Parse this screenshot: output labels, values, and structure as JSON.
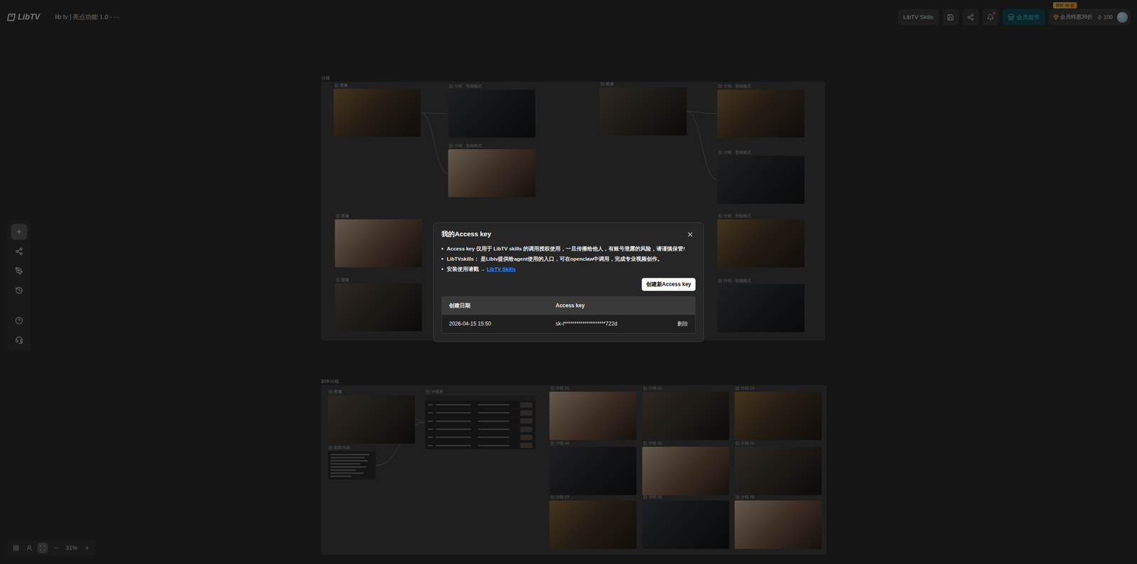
{
  "header": {
    "logo": "LibTV",
    "project_title": "lib tv | 亮点功能 1.0 - ···",
    "skills_button": "LibTV Skills",
    "notification_dot": true,
    "store_button": "会员超市",
    "promo_badge": "限时 39 折",
    "member_offer": "会员特惠39折",
    "credits": "100"
  },
  "toolbar": [
    {
      "selected": true
    },
    {
      "selected": false
    },
    {
      "selected": false
    },
    {
      "selected": false
    },
    {
      "selected": false
    },
    {
      "selected": false
    }
  ],
  "zoom": {
    "value": "31%",
    "tools": [
      {
        "selected": false
      },
      {
        "selected": false
      },
      {
        "selected": true
      }
    ]
  },
  "canvas": {
    "groups": [
      {
        "title": "分镜",
        "nodes": [
          {
            "label": "图像",
            "kind": "image"
          },
          {
            "label": "分镜 · 智能模式",
            "kind": "image"
          },
          {
            "label": "分镜 · 智能模式",
            "kind": "image"
          },
          {
            "label": "图像",
            "kind": "image"
          },
          {
            "label": "分镜 · 智能模式",
            "kind": "image"
          },
          {
            "label": "分镜 · 智能模式",
            "kind": "image"
          },
          {
            "label": "图像",
            "kind": "image"
          },
          {
            "label": "图像",
            "kind": "image"
          },
          {
            "label": "分镜 · 智能模式",
            "kind": "image"
          },
          {
            "label": "分镜 · 智能模式",
            "kind": "image"
          }
        ],
        "edges": [
          {
            "from": 0,
            "to": 1
          },
          {
            "from": 0,
            "to": 2
          },
          {
            "from": 3,
            "to": 4
          },
          {
            "from": 3,
            "to": 5
          }
        ]
      },
      {
        "title": "剧本分镜",
        "nodes": [
          {
            "label": "图像",
            "kind": "image"
          },
          {
            "label": "剧本内容",
            "kind": "text"
          },
          {
            "label": "分镜表",
            "kind": "table"
          },
          {
            "label": "分镜 01",
            "kind": "image"
          },
          {
            "label": "分镜 02",
            "kind": "image"
          },
          {
            "label": "分镜 03",
            "kind": "image"
          },
          {
            "label": "分镜 04",
            "kind": "image"
          },
          {
            "label": "分镜 05",
            "kind": "image"
          },
          {
            "label": "分镜 06",
            "kind": "image"
          },
          {
            "label": "分镜 07",
            "kind": "image"
          },
          {
            "label": "分镜 08",
            "kind": "image"
          },
          {
            "label": "分镜 09",
            "kind": "image"
          }
        ],
        "edges": [
          {
            "from": 0,
            "to": 2
          },
          {
            "from": 1,
            "to": 2
          }
        ]
      }
    ]
  },
  "dialog": {
    "title": "我的Access key",
    "notes": [
      {
        "text": "Access key 仅用于 LibTV skills 的调用授权使用，一旦传播给他人，有账号泄露的风险，请谨慎保管!",
        "link": ""
      },
      {
        "text": "LibTVskills： 是Libtv提供给agent使用的入口，可在openclaw中调用，完成专业视频创作。",
        "link": ""
      },
      {
        "text": "安装使用请戳 → ",
        "link": "LibTV Skills"
      }
    ],
    "create_button": "创建新Access key",
    "table": {
      "columns": [
        "创建日期",
        "Access key"
      ],
      "rows": [
        {
          "created": "2026-04-15 15:50",
          "key": "sk-l********************722d",
          "action": "删除"
        }
      ]
    }
  }
}
